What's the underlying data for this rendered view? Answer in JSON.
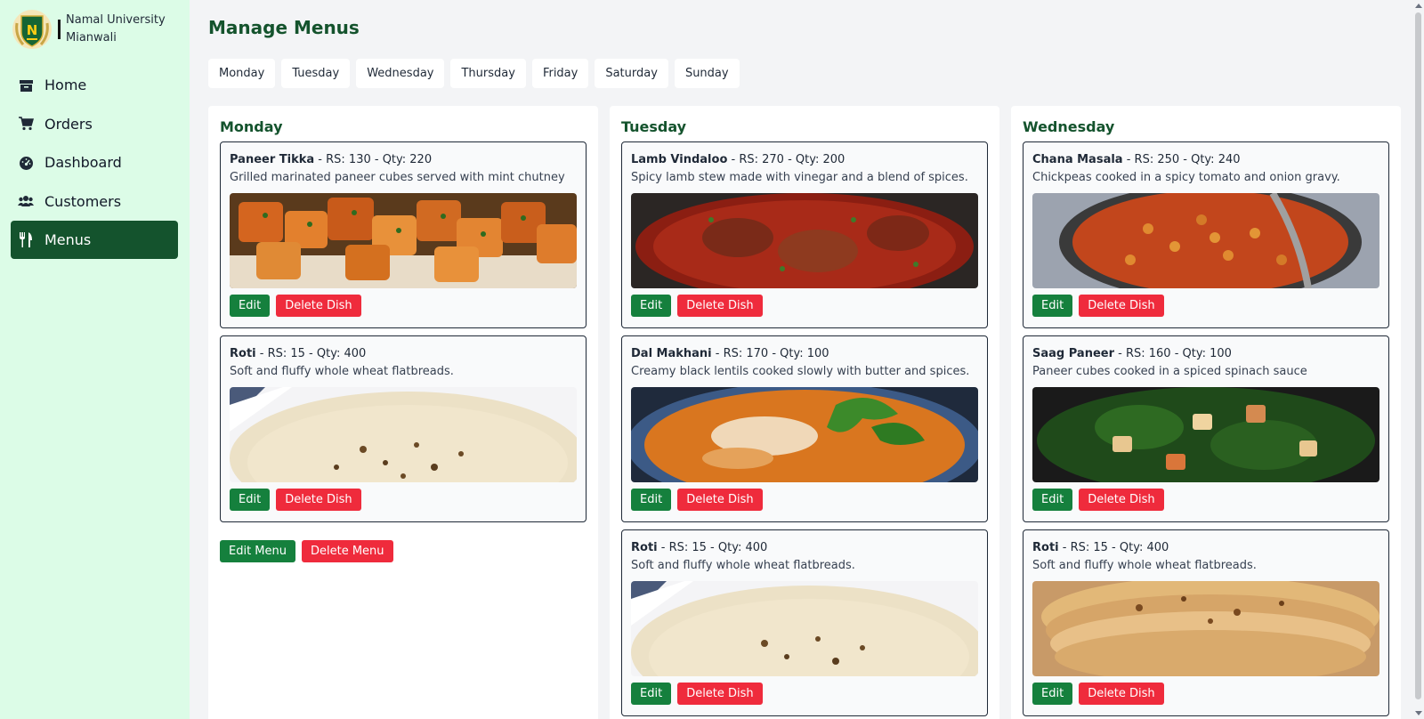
{
  "brand": {
    "name_line1": "Namal University",
    "name_line2": "Mianwali",
    "logo_letter": "N",
    "logo_color": "#14532d"
  },
  "sidebar": {
    "items": [
      {
        "label": "Home",
        "icon": "box-icon",
        "active": false
      },
      {
        "label": "Orders",
        "icon": "cart-icon",
        "active": false
      },
      {
        "label": "Dashboard",
        "icon": "gauge-icon",
        "active": false
      },
      {
        "label": "Customers",
        "icon": "users-icon",
        "active": false
      },
      {
        "label": "Menus",
        "icon": "utensils-icon",
        "active": true
      }
    ]
  },
  "page": {
    "title": "Manage Menus"
  },
  "day_tabs": [
    "Monday",
    "Tuesday",
    "Wednesday",
    "Thursday",
    "Friday",
    "Saturday",
    "Sunday"
  ],
  "columns": [
    {
      "day": "Monday",
      "dishes": [
        {
          "name": "Paneer Tikka",
          "meta": " - RS: 130 - Qty: 220",
          "desc": "Grilled marinated paneer cubes served with mint chutney",
          "image": "paneer-tikka-photo"
        },
        {
          "name": "Roti",
          "meta": " - RS: 15 - Qty: 400",
          "desc": "Soft and fluffy whole wheat flatbreads.",
          "image": "roti-photo"
        }
      ],
      "actions": {
        "edit_menu": "Edit Menu",
        "delete_menu": "Delete Menu"
      }
    },
    {
      "day": "Tuesday",
      "dishes": [
        {
          "name": "Lamb Vindaloo",
          "meta": " - RS: 270 - Qty: 200",
          "desc": "Spicy lamb stew made with vinegar and a blend of spices.",
          "image": "lamb-vindaloo-photo"
        },
        {
          "name": "Dal Makhani",
          "meta": " - RS: 170 - Qty: 100",
          "desc": "Creamy black lentils cooked slowly with butter and spices.",
          "image": "dal-makhani-photo"
        },
        {
          "name": "Roti",
          "meta": " - RS: 15 - Qty: 400",
          "desc": "Soft and fluffy whole wheat flatbreads.",
          "image": "roti-photo"
        }
      ]
    },
    {
      "day": "Wednesday",
      "dishes": [
        {
          "name": "Chana Masala",
          "meta": " - RS: 250 - Qty: 240",
          "desc": "Chickpeas cooked in a spicy tomato and onion gravy.",
          "image": "chana-masala-photo"
        },
        {
          "name": "Saag Paneer",
          "meta": " - RS: 160 - Qty: 100",
          "desc": "Paneer cubes cooked in a spiced spinach sauce",
          "image": "saag-paneer-photo"
        },
        {
          "name": "Roti",
          "meta": " - RS: 15 - Qty: 400",
          "desc": "Soft and fluffy whole wheat flatbreads.",
          "image": "roti-stack-photo"
        }
      ]
    }
  ],
  "buttons": {
    "edit": "Edit",
    "delete_dish": "Delete Dish"
  },
  "colors": {
    "sidebar_bg": "#dcfce7",
    "accent": "#14532d",
    "edit_green": "#15803d",
    "delete_red": "#ef2b3c"
  }
}
